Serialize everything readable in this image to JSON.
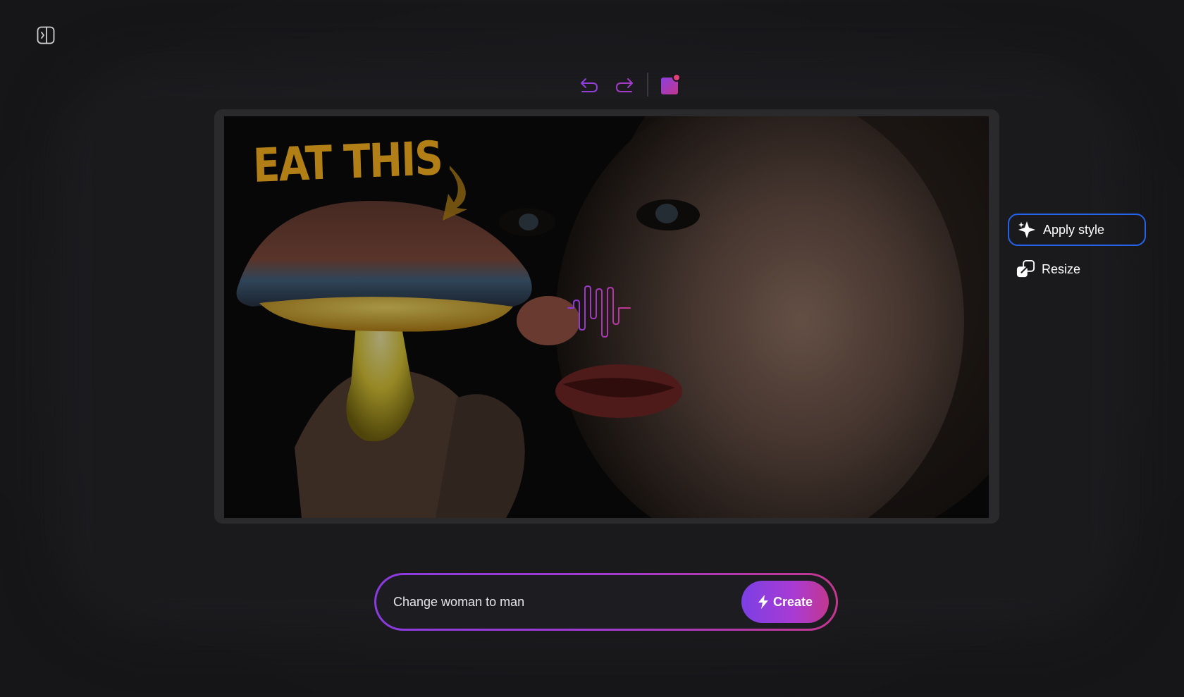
{
  "sidebar": {
    "toggle_icon": "sidebar-toggle-icon"
  },
  "toolbar": {
    "undo_icon": "undo-icon",
    "redo_icon": "redo-icon",
    "layers_icon": "canvas-layers-icon",
    "accent": "#a53ad8"
  },
  "canvas": {
    "headline": "EAT THIS",
    "image_description_icon": "canvas-image",
    "loading_indicator": "waveform-icon"
  },
  "side_actions": [
    {
      "label": "Apply style",
      "icon": "sparkle-icon",
      "active": true
    },
    {
      "label": "Resize",
      "icon": "resize-icon",
      "active": false
    }
  ],
  "prompt": {
    "value": "Change woman to man",
    "create_label": "Create",
    "create_icon": "lightning-icon"
  },
  "colors": {
    "background": "#161618",
    "active_outline": "#2563eb",
    "gradient_start": "#7b3fe4",
    "gradient_end": "#c2378f"
  }
}
